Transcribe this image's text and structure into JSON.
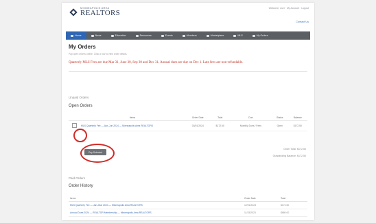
{
  "brand": {
    "name_small": "MINNEAPOLIS AREA",
    "name_big": "REALTORS"
  },
  "header": {
    "user_links": "Welcome, user  ·  My Account  ·  Logout",
    "contact": "Contact Us"
  },
  "nav": [
    {
      "label": "Home",
      "active": true
    },
    {
      "label": "News"
    },
    {
      "label": "Education"
    },
    {
      "label": "Resources"
    },
    {
      "label": "Events"
    },
    {
      "label": "Members"
    },
    {
      "label": "Marketplace"
    },
    {
      "label": "MLS"
    },
    {
      "label": "My Orders"
    }
  ],
  "page": {
    "title": "My Orders",
    "helper": "Pay open orders online. Click a row to view order details.",
    "notice": "Quarterly MLS Fees are due Mar 31, June 30, Sep 30 and Dec 31.  Annual dues are due on Dec 1.  Late fees are non-refundable."
  },
  "unpaid": {
    "section_label": "Unpaid Orders",
    "heading": "Open Orders",
    "columns": [
      "Items",
      "Order Date",
      "Total",
      "Due",
      "Status",
      "Balance"
    ],
    "rows": [
      {
        "items": "MLS Quarterly Fee — Apr–Jun 2024 — Minneapolis Area REALTORS",
        "order_date": "03/01/2024",
        "total": "$172.50",
        "due": "Monthly Dues / Fees",
        "status": "Open",
        "balance": "$172.50"
      }
    ],
    "order_total": "Order Total: $172.50",
    "balance": "Outstanding Balance: $172.50",
    "pay_button": "Pay Selected"
  },
  "history": {
    "section_label": "Paid Orders",
    "heading": "Order History",
    "columns": [
      "Items",
      "Order Date",
      "Total"
    ],
    "rows": [
      {
        "items": "MLS Quarterly Fee — Jan–Mar 2024 — Minneapolis Area REALTORS",
        "order_date": "12/01/2023",
        "total": "$172.50"
      },
      {
        "items": "Annual Dues 2024 — REALTOR Membership — Minneapolis Area REALTORS",
        "order_date": "11/15/2023",
        "total": "$680.00"
      }
    ]
  },
  "colors": {
    "accent": "#2f66b3",
    "nav": "#5b5e63",
    "notice": "#c0392b",
    "highlight": "#d12b26"
  }
}
